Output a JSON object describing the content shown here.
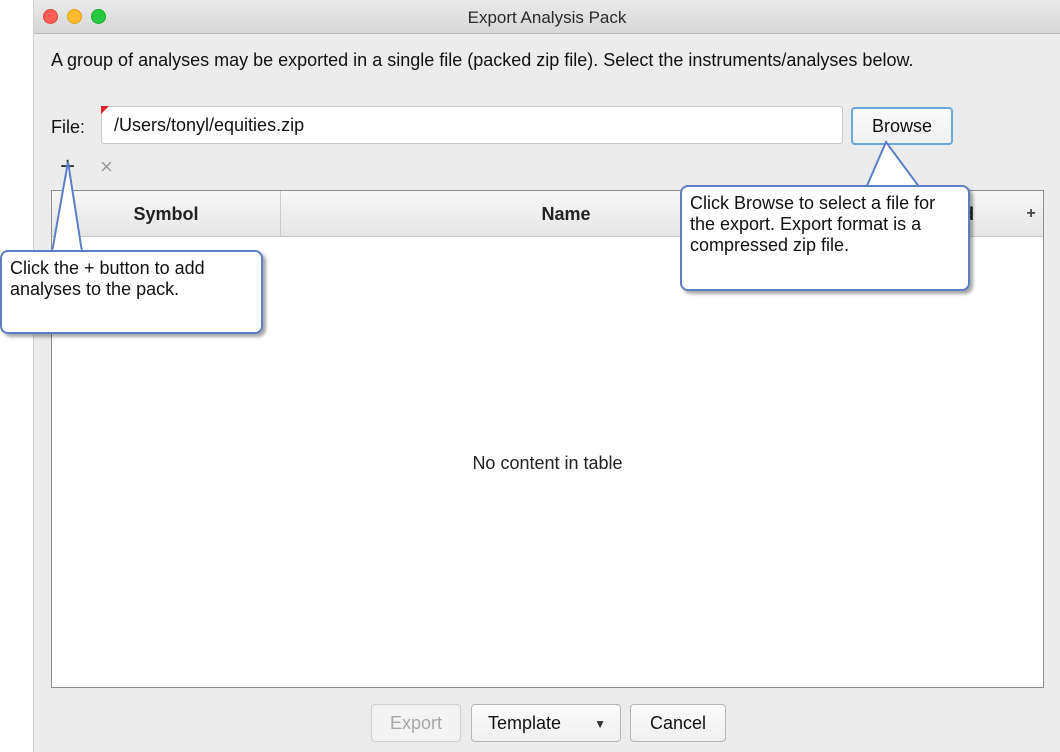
{
  "window": {
    "title": "Export Analysis Pack",
    "colors": {
      "close": "#fe5f57",
      "minimize": "#febc2e",
      "maximize": "#28c840"
    }
  },
  "description": "A group of analyses may be exported in a single file (packed zip file). Select the instruments/analyses below.",
  "file": {
    "label": "File:",
    "value": "/Users/tonyl/equities.zip",
    "browse_label": "Browse"
  },
  "toolbar": {
    "add_icon": "plus-icon",
    "remove_icon": "close-icon",
    "add_glyph": "+",
    "remove_glyph": "×"
  },
  "table": {
    "columns": [
      "Symbol",
      "Name",
      "ted",
      "+"
    ],
    "empty_text": "No content in table"
  },
  "footer": {
    "export_label": "Export",
    "template_label": "Template",
    "cancel_label": "Cancel"
  },
  "callouts": {
    "plus": "Click the + button to add analyses to the pack.",
    "browse": "Click Browse to select a file for the export.  Export format is a compressed zip file."
  }
}
